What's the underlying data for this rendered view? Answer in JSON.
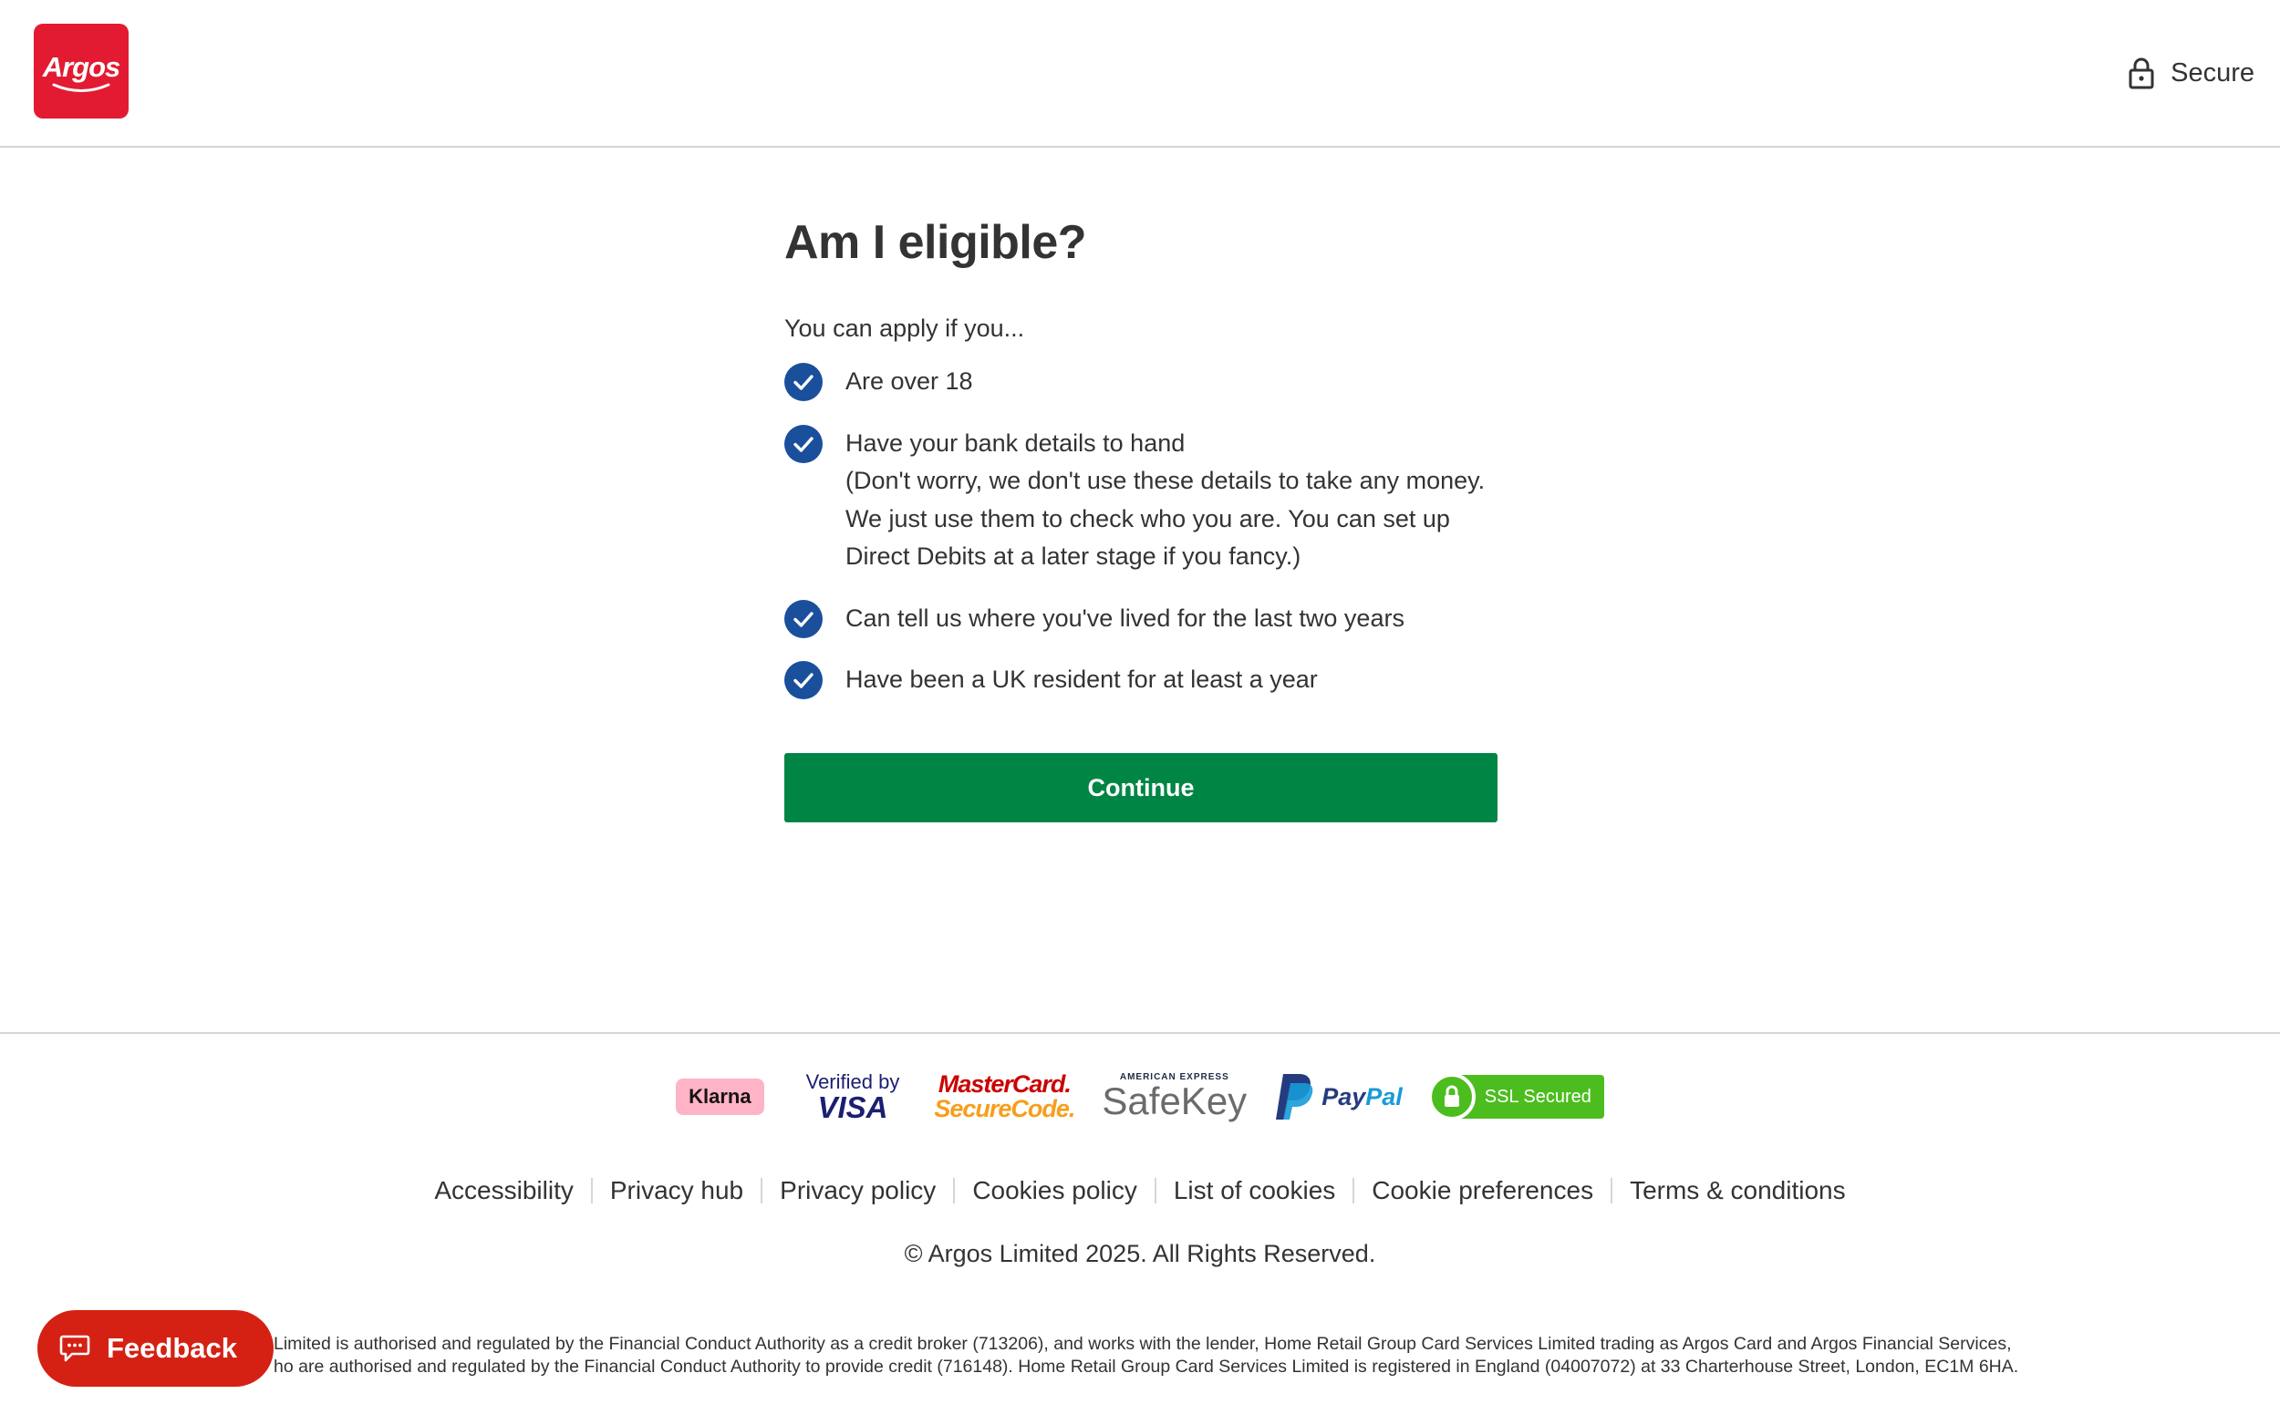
{
  "header": {
    "logo_text": "Argos",
    "secure_label": "Secure"
  },
  "main": {
    "title": "Am I eligible?",
    "intro": "You can apply if you...",
    "items": [
      {
        "text": "Are over 18"
      },
      {
        "text": "Have your bank details to hand",
        "note": "(Don't worry, we don't use these details to take any money. We just use them to check who you are. You can set up Direct Debits at a later stage if you fancy.)"
      },
      {
        "text": "Can tell us where you've lived for the last two years"
      },
      {
        "text": "Have been a UK resident for at least a year"
      }
    ],
    "continue_label": "Continue"
  },
  "footer": {
    "payments": {
      "klarna": "Klarna",
      "visa_top": "Verified by",
      "visa_bottom": "VISA",
      "mc_top": "MasterCard.",
      "mc_bottom": "SecureCode.",
      "amex_top": "AMERICAN EXPRESS",
      "amex_bottom": "SafeKey",
      "paypal_a": "Pay",
      "paypal_b": "Pal",
      "ssl": "SSL Secured"
    },
    "links": [
      "Accessibility",
      "Privacy hub",
      "Privacy policy",
      "Cookies policy",
      "List of cookies",
      "Cookie preferences",
      "Terms & conditions"
    ],
    "copyright": "© Argos Limited 2025. All Rights Reserved.",
    "legal_line1": "Limited is authorised and regulated by the Financial Conduct Authority as a credit broker (713206), and works with the lender, Home Retail Group Card Services Limited trading as Argos Card and Argos Financial Services,",
    "legal_line2": "ho are authorised and regulated by the Financial Conduct Authority to provide credit (716148). Home Retail Group Card Services Limited is registered in England (04007072) at 33 Charterhouse Street, London, EC1M 6HA."
  },
  "feedback_label": "Feedback",
  "colors": {
    "brand_red": "#e21b32",
    "check_blue": "#1a4f9c",
    "continue_green": "#008545",
    "feedback_red": "#d42114"
  },
  "icons": {
    "secure": "lock-icon",
    "check": "check-circle-icon",
    "feedback": "chat-bubble-icon"
  }
}
